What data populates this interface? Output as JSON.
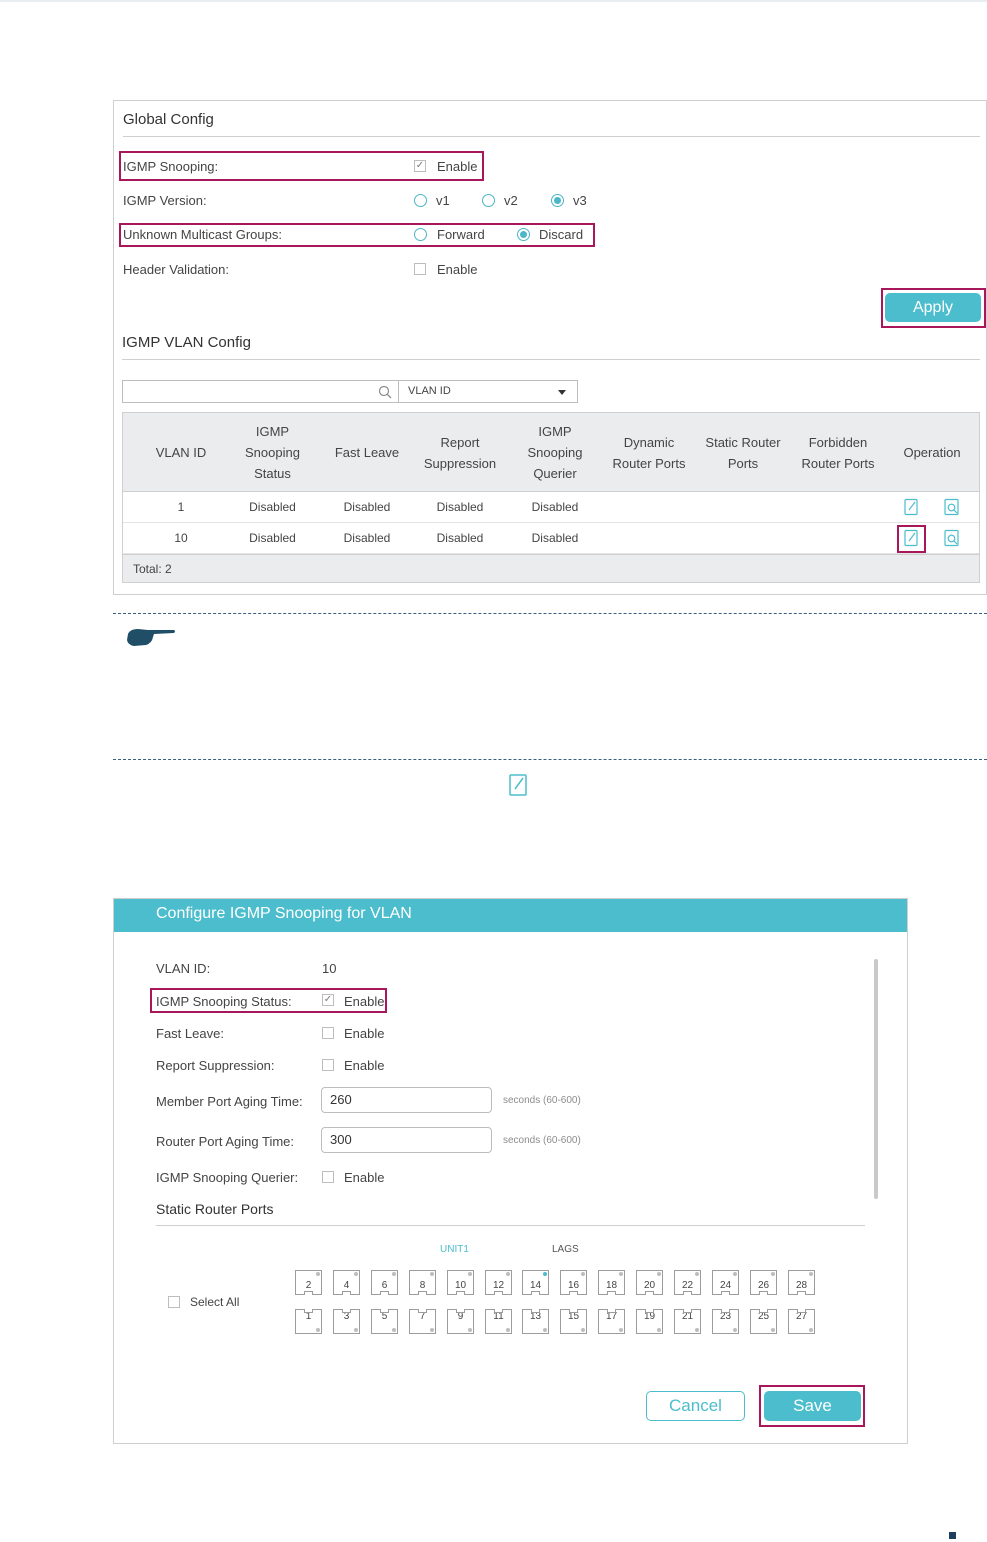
{
  "global_config": {
    "title": "Global Config",
    "igmp_snooping": {
      "label": "IGMP Snooping:",
      "option": "Enable",
      "checked": true
    },
    "igmp_version": {
      "label": "IGMP Version:",
      "options": [
        "v1",
        "v2",
        "v3"
      ],
      "selected": "v3"
    },
    "unknown_multicast": {
      "label": "Unknown Multicast Groups:",
      "options": [
        "Forward",
        "Discard"
      ],
      "selected": "Discard"
    },
    "header_validation": {
      "label": "Header Validation:",
      "option": "Enable",
      "checked": false
    },
    "apply_label": "Apply"
  },
  "vlan_config": {
    "title": "IGMP VLAN Config",
    "search": {
      "value": "",
      "placeholder": ""
    },
    "filter_select": "VLAN ID",
    "columns": [
      "VLAN ID",
      "IGMP Snooping Status",
      "Fast Leave",
      "Report Suppression",
      "IGMP Snooping Querier",
      "Dynamic Router Ports",
      "Static Router Ports",
      "Forbidden Router Ports",
      "Operation"
    ],
    "rows": [
      {
        "vlan_id": "1",
        "status": "Disabled",
        "fast_leave": "Disabled",
        "report_suppression": "Disabled",
        "querier": "Disabled",
        "dynamic": "",
        "static": "",
        "forbidden": ""
      },
      {
        "vlan_id": "10",
        "status": "Disabled",
        "fast_leave": "Disabled",
        "report_suppression": "Disabled",
        "querier": "Disabled",
        "dynamic": "",
        "static": "",
        "forbidden": ""
      }
    ],
    "total": "Total: 2"
  },
  "dialog": {
    "title": "Configure IGMP Snooping for VLAN",
    "vlan_id": {
      "label": "VLAN ID:",
      "value": "10"
    },
    "snooping_status": {
      "label": "IGMP Snooping Status:",
      "option": "Enable",
      "checked": true
    },
    "fast_leave": {
      "label": "Fast Leave:",
      "option": "Enable",
      "checked": false
    },
    "report_suppression": {
      "label": "Report Suppression:",
      "option": "Enable",
      "checked": false
    },
    "member_aging": {
      "label": "Member Port Aging Time:",
      "value": "260",
      "hint": "seconds (60-600)"
    },
    "router_aging": {
      "label": "Router Port Aging Time:",
      "value": "300",
      "hint": "seconds (60-600)"
    },
    "querier": {
      "label": "IGMP Snooping Querier:",
      "option": "Enable",
      "checked": false
    },
    "static_router_ports": {
      "title": "Static Router Ports",
      "tab_unit": "UNIT1",
      "tab_lags": "LAGS",
      "select_all": "Select All",
      "top_ports": [
        "2",
        "4",
        "6",
        "8",
        "10",
        "12",
        "14",
        "16",
        "18",
        "20",
        "22",
        "24",
        "26",
        "28"
      ],
      "bottom_ports": [
        "1",
        "3",
        "5",
        "7",
        "9",
        "11",
        "13",
        "15",
        "17",
        "19",
        "21",
        "23",
        "25",
        "27"
      ],
      "active_port": "14"
    },
    "cancel_label": "Cancel",
    "save_label": "Save"
  },
  "colors": {
    "accent": "#4bbdcc",
    "highlight": "#a8175a",
    "header_bg": "#eaecee"
  },
  "icons": [
    "search-icon",
    "edit-icon",
    "view-icon",
    "pointing-hand-icon",
    "checkbox-icon",
    "caret-down-icon"
  ]
}
